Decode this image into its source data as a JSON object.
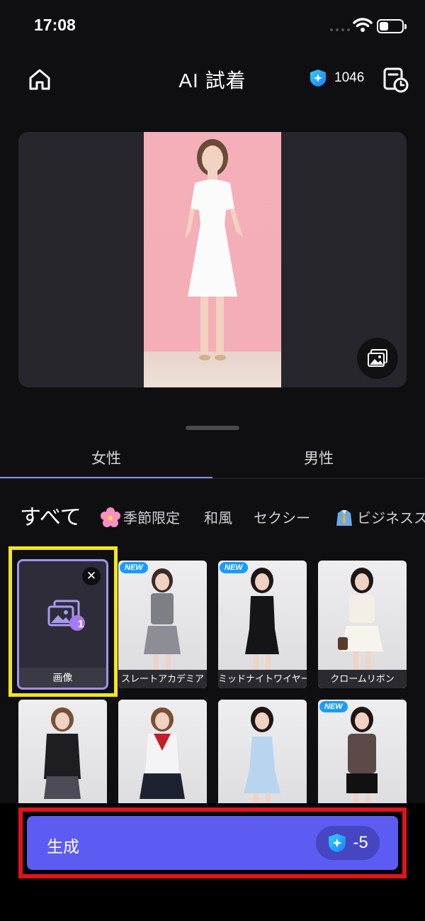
{
  "status_bar": {
    "time": "17:08"
  },
  "header": {
    "title": "AI 試着",
    "credits": "1046"
  },
  "preview": {},
  "tabs": [
    {
      "label": "女性"
    },
    {
      "label": "男性"
    }
  ],
  "categories": [
    {
      "label": "すべて"
    },
    {
      "label": "季節限定"
    },
    {
      "label": "和風"
    },
    {
      "label": "セクシー"
    },
    {
      "label": "ビジネスス"
    }
  ],
  "upload_card": {
    "label": "画像",
    "count": "1"
  },
  "outfits": [
    {
      "label": "スレートアカデミア",
      "badge": "NEW"
    },
    {
      "label": "ミッドナイトワイヤー",
      "badge": "NEW"
    },
    {
      "label": "クロームリボン",
      "badge": ""
    },
    {
      "label": "",
      "badge": ""
    },
    {
      "label": "",
      "badge": ""
    },
    {
      "label": "",
      "badge": ""
    },
    {
      "label": "",
      "badge": "NEW"
    }
  ],
  "generate": {
    "label": "生成",
    "cost": "-5"
  },
  "colors": {
    "accent": "#5c5cf2",
    "highlight_yellow": "#f5e51c",
    "highlight_red": "#e0131b",
    "new_badge": "#1a9bff"
  }
}
